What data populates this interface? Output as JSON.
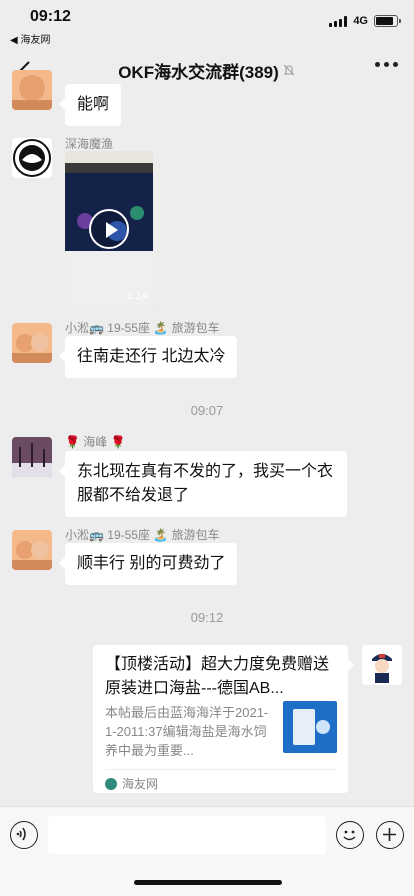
{
  "status_bar": {
    "time": "09:12",
    "back_app": "◀ 海友网",
    "network": "4G",
    "battery_level": 0.85
  },
  "header": {
    "title": "OKF海水交流群(389)",
    "muted_icon": "bell-off-icon"
  },
  "messages": [
    {
      "type": "text",
      "side": "left",
      "avatar": "couple-avatar",
      "text": "能啊"
    },
    {
      "type": "video",
      "side": "left",
      "sender": "深海魔渔",
      "avatar": "big-fish-logo",
      "duration": "1:14"
    },
    {
      "type": "text",
      "side": "left",
      "sender": "小淞🚌 19-55座 🏝️ 旅游包车",
      "avatar": "couple-avatar",
      "text": "往南走还行 北边太冷"
    },
    {
      "type": "time",
      "text": "09:07"
    },
    {
      "type": "text",
      "side": "left",
      "sender": "🌹 海峰 🌹",
      "avatar": "snow-trees-avatar",
      "text": "东北现在真有不发的了，我买一个衣服都不给发退了"
    },
    {
      "type": "text",
      "side": "left",
      "sender": "小淞🚌 19-55座 🏝️ 旅游包车",
      "avatar": "couple-avatar",
      "text": "顺丰行 别的可费劲了"
    },
    {
      "type": "time",
      "text": "09:12"
    },
    {
      "type": "link_card",
      "side": "right",
      "avatar": "cartoon-police-avatar",
      "title": "【顶楼活动】超大力度免费赠送原装进口海盐---德国AB...",
      "description": "本帖最后由蓝海海洋于2021-1-2011:37编辑海盐是海水饲养中最为重要...",
      "source": "海友网"
    }
  ],
  "input_bar": {
    "placeholder": ""
  },
  "colors": {
    "background": "#ededed",
    "bubble": "#ffffff",
    "source_icon": "#2d8a7d"
  }
}
